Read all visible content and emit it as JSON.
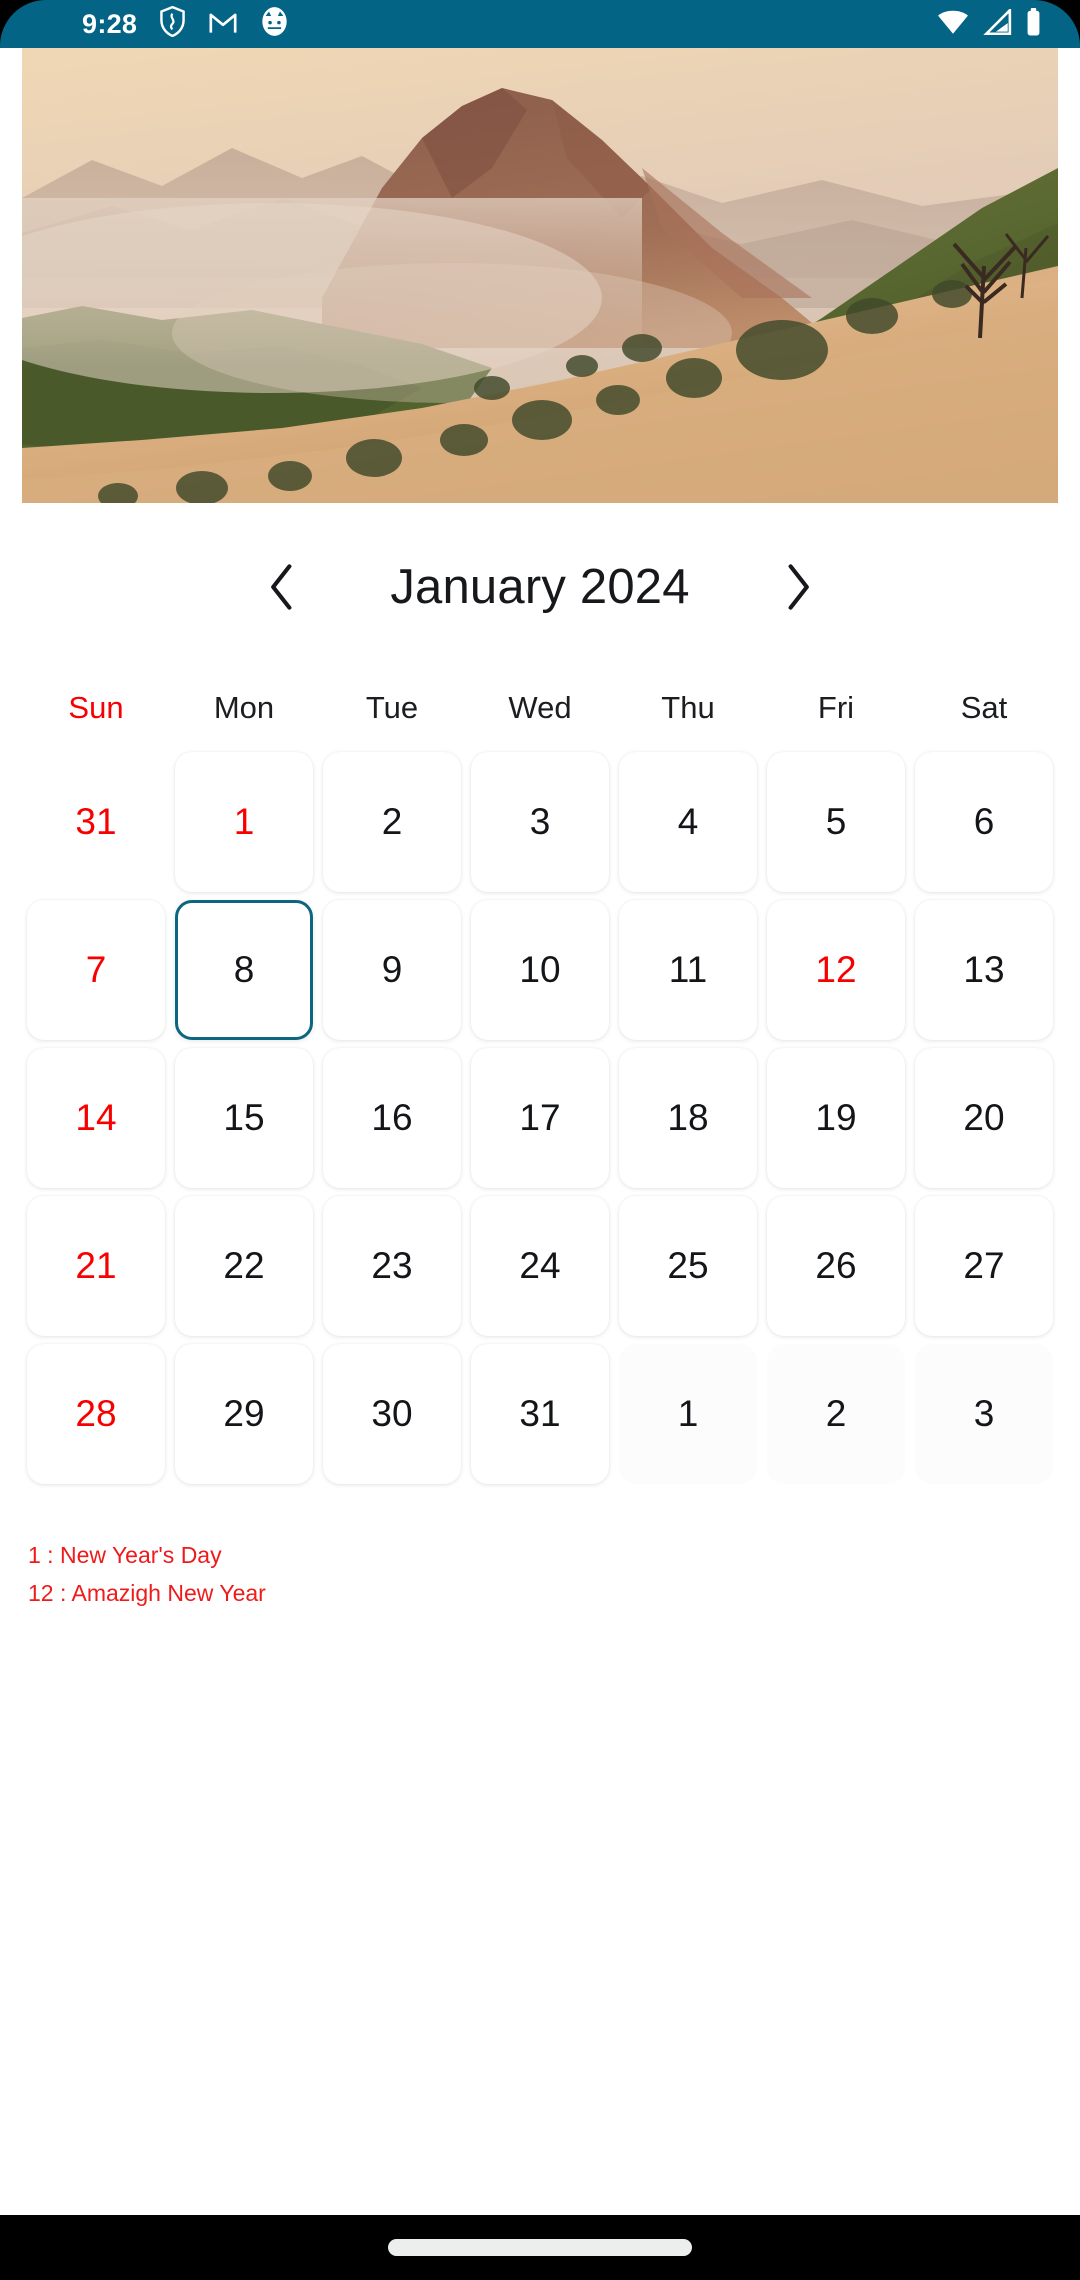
{
  "status_bar": {
    "time": "9:28",
    "background_color": "#046486",
    "left_icons": [
      {
        "name": "shield-icon",
        "label": "Shield"
      },
      {
        "name": "gmail-icon",
        "label": "M"
      },
      {
        "name": "face-circle-icon",
        "label": "Face"
      }
    ],
    "right_icons": [
      {
        "name": "wifi-icon",
        "label": "Wi-Fi"
      },
      {
        "name": "cellular-signal-icon",
        "label": "Signal"
      },
      {
        "name": "battery-icon",
        "label": "Battery"
      }
    ]
  },
  "hero": {
    "alt": "Hazy mountain valley at sunrise with green scrub slopes and golden grass",
    "sky_color": "#e8c9a2",
    "rock_color": "#9a6a52",
    "green_color": "#5d6b35",
    "grass_color": "#d5a974"
  },
  "calendar": {
    "prev_label": "‹",
    "next_label": "›",
    "title": "January 2024",
    "weekdays": [
      "Sun",
      "Mon",
      "Tue",
      "Wed",
      "Thu",
      "Fri",
      "Sat"
    ],
    "sunday_color": "#f80000",
    "holiday_color": "#f80000",
    "selected_color": "#0d6680",
    "selected_day": 8,
    "weeks": [
      [
        {
          "label": "31",
          "variant": "prev",
          "red": true
        },
        {
          "label": "1",
          "variant": "current",
          "red": true
        },
        {
          "label": "2",
          "variant": "current",
          "red": false
        },
        {
          "label": "3",
          "variant": "current",
          "red": false
        },
        {
          "label": "4",
          "variant": "current",
          "red": false
        },
        {
          "label": "5",
          "variant": "current",
          "red": false
        },
        {
          "label": "6",
          "variant": "current",
          "red": false
        }
      ],
      [
        {
          "label": "7",
          "variant": "current",
          "red": true
        },
        {
          "label": "8",
          "variant": "current",
          "red": false,
          "selected": true
        },
        {
          "label": "9",
          "variant": "current",
          "red": false
        },
        {
          "label": "10",
          "variant": "current",
          "red": false
        },
        {
          "label": "11",
          "variant": "current",
          "red": false
        },
        {
          "label": "12",
          "variant": "current",
          "red": true
        },
        {
          "label": "13",
          "variant": "current",
          "red": false
        }
      ],
      [
        {
          "label": "14",
          "variant": "current",
          "red": true
        },
        {
          "label": "15",
          "variant": "current",
          "red": false
        },
        {
          "label": "16",
          "variant": "current",
          "red": false
        },
        {
          "label": "17",
          "variant": "current",
          "red": false
        },
        {
          "label": "18",
          "variant": "current",
          "red": false
        },
        {
          "label": "19",
          "variant": "current",
          "red": false
        },
        {
          "label": "20",
          "variant": "current",
          "red": false
        }
      ],
      [
        {
          "label": "21",
          "variant": "current",
          "red": true
        },
        {
          "label": "22",
          "variant": "current",
          "red": false
        },
        {
          "label": "23",
          "variant": "current",
          "red": false
        },
        {
          "label": "24",
          "variant": "current",
          "red": false
        },
        {
          "label": "25",
          "variant": "current",
          "red": false
        },
        {
          "label": "26",
          "variant": "current",
          "red": false
        },
        {
          "label": "27",
          "variant": "current",
          "red": false
        }
      ],
      [
        {
          "label": "28",
          "variant": "current",
          "red": true
        },
        {
          "label": "29",
          "variant": "current",
          "red": false
        },
        {
          "label": "30",
          "variant": "current",
          "red": false
        },
        {
          "label": "31",
          "variant": "current",
          "red": false
        },
        {
          "label": "1",
          "variant": "next",
          "red": false
        },
        {
          "label": "2",
          "variant": "next",
          "red": false
        },
        {
          "label": "3",
          "variant": "next",
          "red": false
        }
      ]
    ],
    "legend": [
      "1 : New Year's Day",
      "12 : Amazigh New Year"
    ]
  },
  "nav_bar": {
    "home_indicator": "home-indicator"
  }
}
